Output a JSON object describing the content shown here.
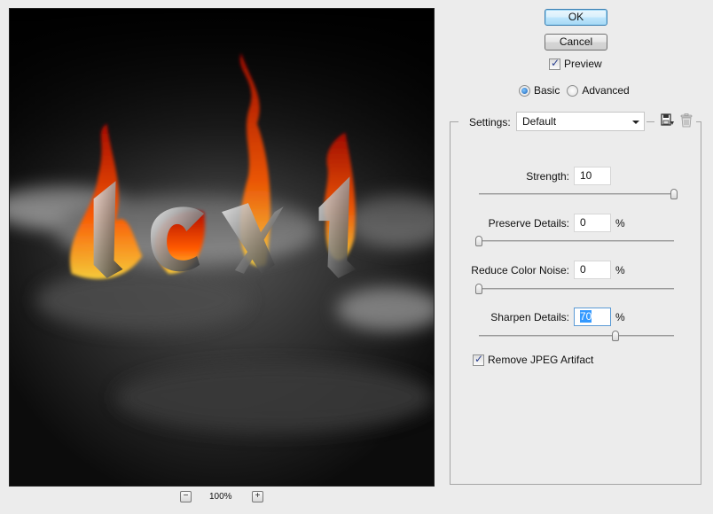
{
  "buttons": {
    "ok": "OK",
    "cancel": "Cancel"
  },
  "preview_checkbox": {
    "label": "Preview",
    "checked": true
  },
  "mode": {
    "options": [
      "Basic",
      "Advanced"
    ],
    "selected": "Basic"
  },
  "settings": {
    "label": "Settings:",
    "value": "Default",
    "icons": [
      "save-settings-icon",
      "delete-settings-icon"
    ]
  },
  "params": [
    {
      "label": "Strength:",
      "value": "10",
      "unit": "",
      "min": 0,
      "max": 10,
      "slider_value": 10
    },
    {
      "label": "Preserve Details:",
      "value": "0",
      "unit": "%",
      "min": 0,
      "max": 100,
      "slider_value": 0
    },
    {
      "label": "Reduce Color Noise:",
      "value": "0",
      "unit": "%",
      "min": 0,
      "max": 100,
      "slider_value": 0
    },
    {
      "label": "Sharpen Details:",
      "value": "70",
      "unit": "%",
      "min": 0,
      "max": 100,
      "slider_value": 70
    }
  ],
  "jpeg_checkbox": {
    "label": "Remove JPEG Artifact",
    "checked": true
  },
  "zoom": {
    "value": "100%",
    "minus": "−",
    "plus": "+"
  },
  "preview_image": {
    "description": "Fiery metallic text artwork reading 'text'",
    "text": "text"
  }
}
